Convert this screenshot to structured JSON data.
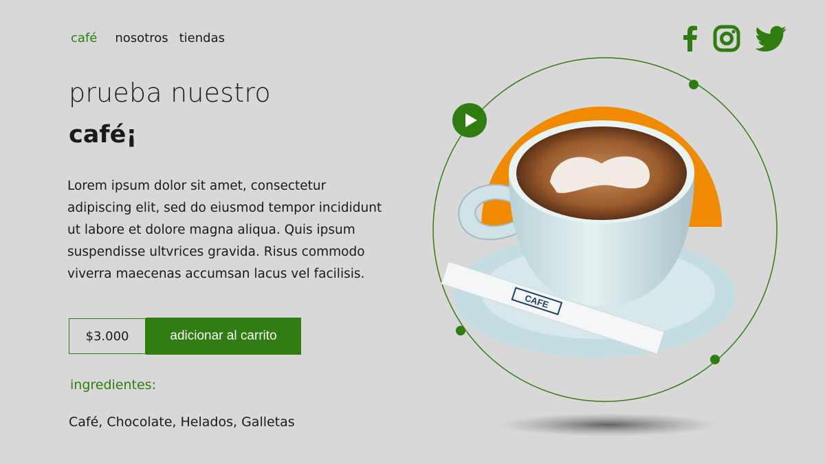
{
  "nav": {
    "items": [
      {
        "label": "café",
        "active": true
      },
      {
        "label": "nosotros",
        "active": false
      },
      {
        "label": "tiendas",
        "active": false
      }
    ]
  },
  "social": [
    "facebook-icon",
    "instagram-icon",
    "twitter-icon"
  ],
  "hero": {
    "line1": "prueba nuestro",
    "line2": "café¡"
  },
  "description": "Lorem ipsum dolor sit amet, consectetur adipiscing elit, sed do eiusmod tempor incididunt ut labore et dolore magna aliqua. Quis ipsum suspendisse ultvrices gravida. Risus commodo viverra maecenas accumsan lacus vel facilisis.",
  "purchase": {
    "price": "$3.000",
    "button_label": "adicionar al carrito"
  },
  "ingredients": {
    "title": "ingredientes:",
    "list": "Café, Chocolate, Helados, Galletas"
  },
  "product": {
    "sachet_text": "CAFE"
  },
  "colors": {
    "accent": "#2f7d10",
    "orange": "#f08a00",
    "background": "#d8d8d8"
  }
}
